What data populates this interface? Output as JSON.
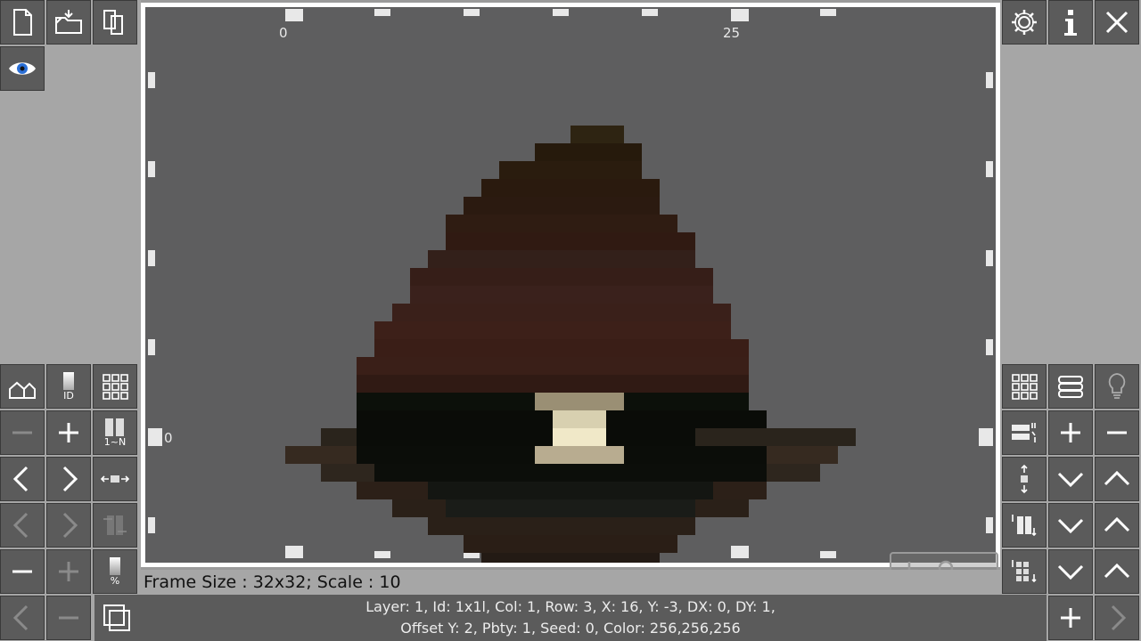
{
  "canvas": {
    "ruler_top": [
      "0",
      "25"
    ],
    "ruler_left": [
      "0"
    ]
  },
  "status": {
    "frame_text": "Frame Size : 32x32; Scale : 10"
  },
  "info": {
    "line1": "Layer: 1, Id: 1x1l, Col: 1, Row: 3, X: 16, Y: -3, DX: 0, DY: 1,",
    "line2": "Offset Y: 2, Pbty: 1, Seed: 0, Color: 256,256,256"
  },
  "icons": {
    "new": "new-file-icon",
    "open": "open-folder-icon",
    "copy": "copy-icon",
    "eye": "eye-icon",
    "settings": "gear-icon",
    "info": "info-icon",
    "close": "close-icon"
  },
  "labels": {
    "id_badge": "ID",
    "range_badge": "1~N",
    "percent_badge": "%"
  }
}
